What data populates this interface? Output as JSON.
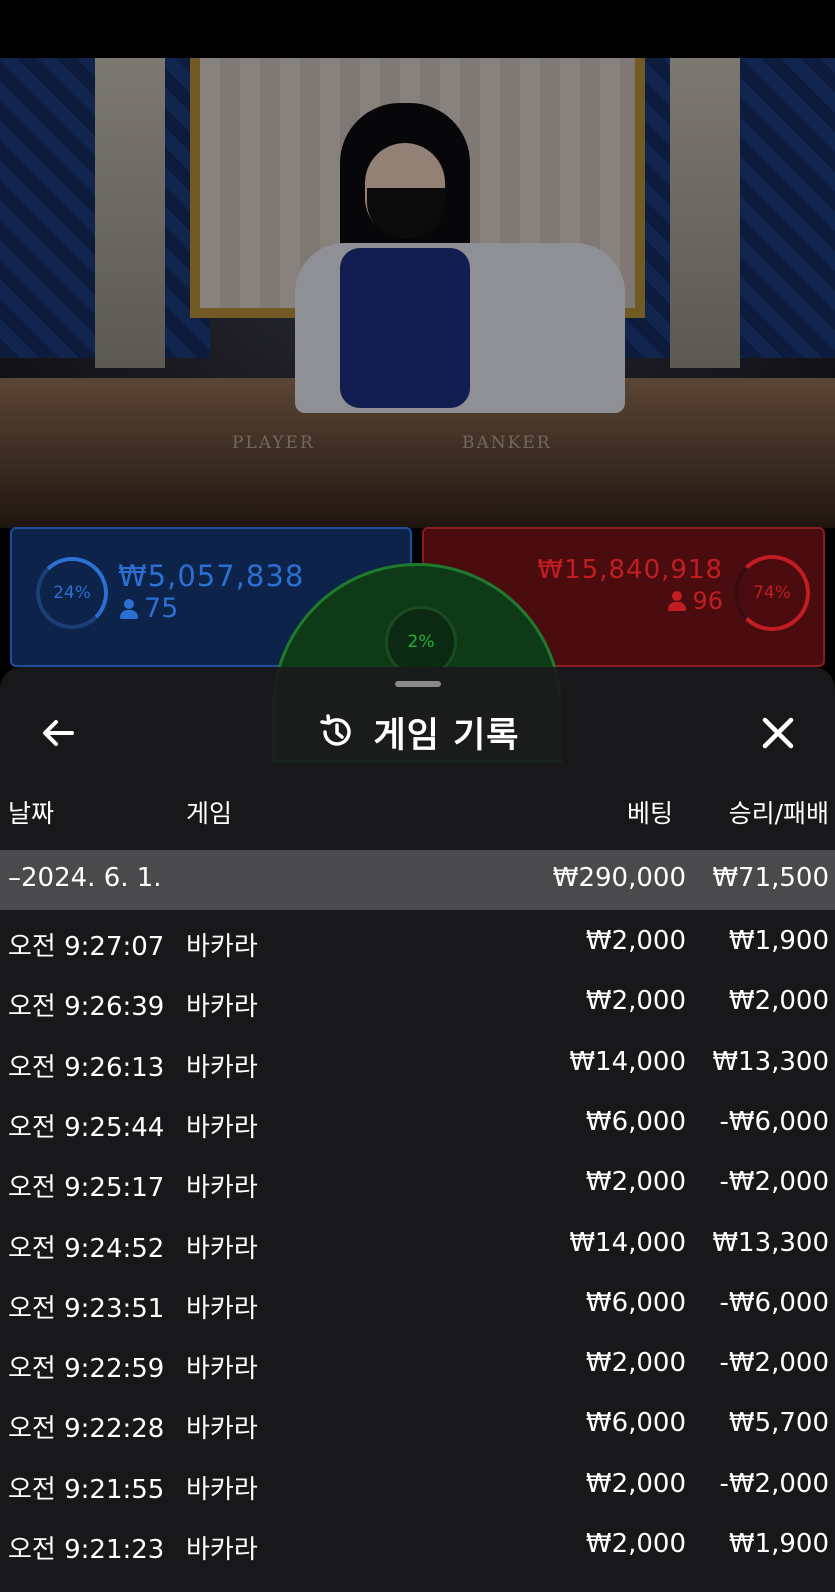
{
  "live": {
    "table_left_text": "PLAYER",
    "table_right_text": "BANKER",
    "player": {
      "percent": "24%",
      "amount": "₩5,057,838",
      "count": "75"
    },
    "banker": {
      "percent": "74%",
      "amount": "₩15,840,918",
      "count": "96"
    },
    "tie": {
      "percent": "2%"
    },
    "colors": {
      "player": "#2a6fd1",
      "banker": "#c11d22",
      "tie": "#21b33a"
    }
  },
  "sheet": {
    "title": "게임 기록",
    "back_icon": "arrow-left-icon",
    "history_icon": "history-icon",
    "close_icon": "close-icon",
    "columns": {
      "date": "날짜",
      "game": "게임",
      "bet": "베팅",
      "winloss": "승리/패배"
    },
    "summary": {
      "date": "–2024. 6. 1.",
      "bet": "₩290,000",
      "winloss": "₩71,500"
    },
    "rows": [
      {
        "time": "오전 9:27:07",
        "game": "바카라",
        "bet": "₩2,000",
        "winloss": "₩1,900"
      },
      {
        "time": "오전 9:26:39",
        "game": "바카라",
        "bet": "₩2,000",
        "winloss": "₩2,000"
      },
      {
        "time": "오전 9:26:13",
        "game": "바카라",
        "bet": "₩14,000",
        "winloss": "₩13,300"
      },
      {
        "time": "오전 9:25:44",
        "game": "바카라",
        "bet": "₩6,000",
        "winloss": "-₩6,000"
      },
      {
        "time": "오전 9:25:17",
        "game": "바카라",
        "bet": "₩2,000",
        "winloss": "-₩2,000"
      },
      {
        "time": "오전 9:24:52",
        "game": "바카라",
        "bet": "₩14,000",
        "winloss": "₩13,300"
      },
      {
        "time": "오전 9:23:51",
        "game": "바카라",
        "bet": "₩6,000",
        "winloss": "-₩6,000"
      },
      {
        "time": "오전 9:22:59",
        "game": "바카라",
        "bet": "₩2,000",
        "winloss": "-₩2,000"
      },
      {
        "time": "오전 9:22:28",
        "game": "바카라",
        "bet": "₩6,000",
        "winloss": "₩5,700"
      },
      {
        "time": "오전 9:21:55",
        "game": "바카라",
        "bet": "₩2,000",
        "winloss": "-₩2,000"
      },
      {
        "time": "오전 9:21:23",
        "game": "바카라",
        "bet": "₩2,000",
        "winloss": "₩1,900"
      }
    ]
  }
}
